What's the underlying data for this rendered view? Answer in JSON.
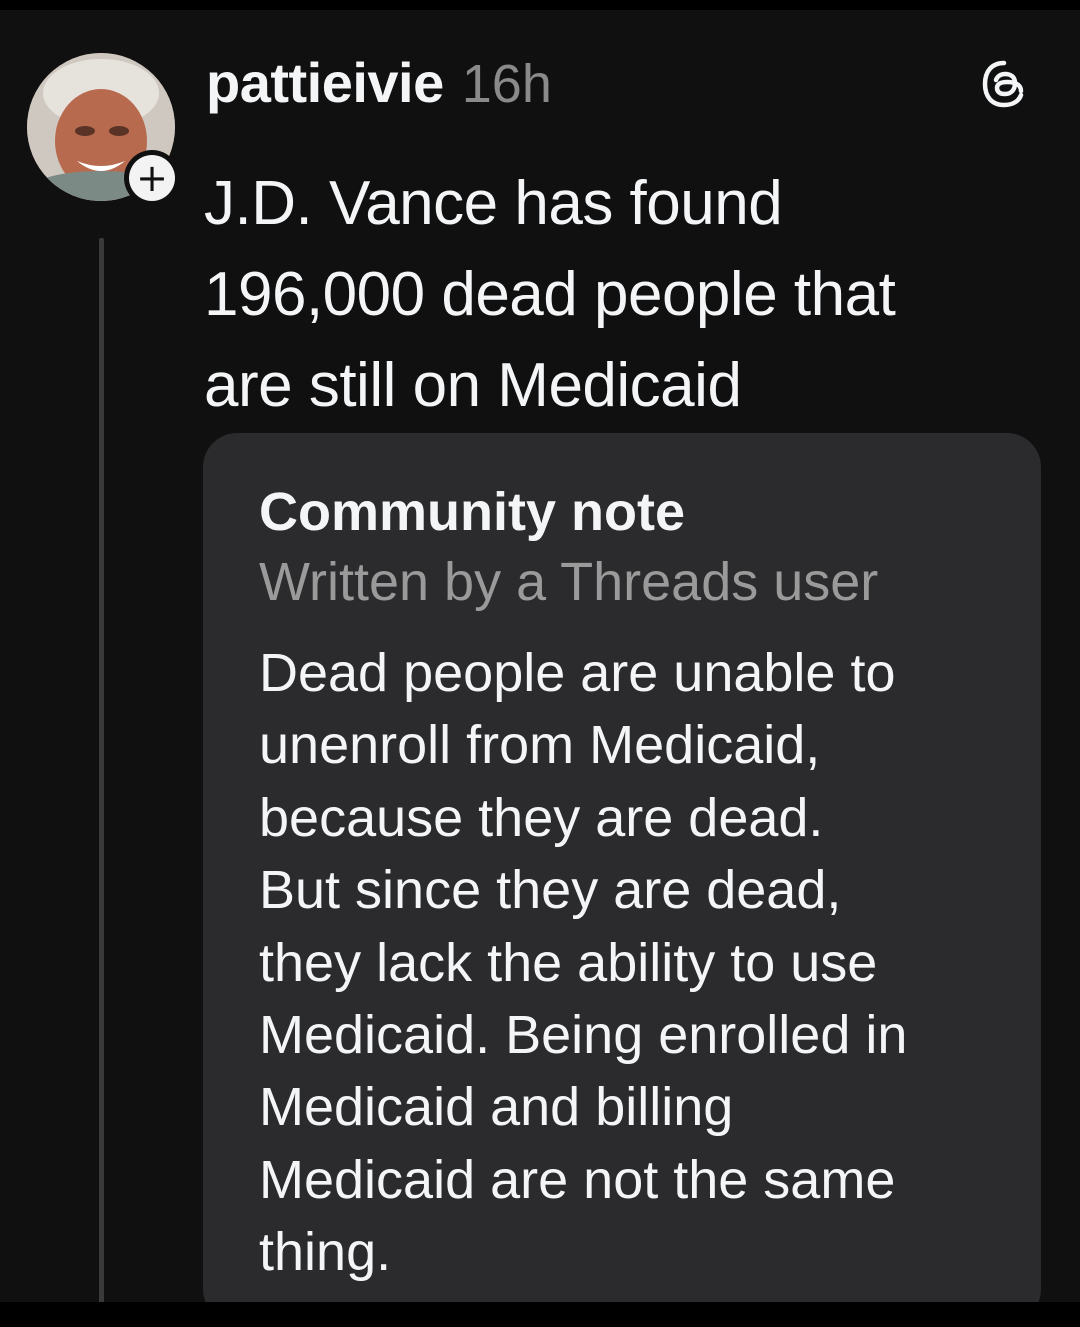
{
  "post": {
    "username": "pattieivie",
    "timestamp": "16h",
    "text_lines": [
      "J.D. Vance has found",
      "196,000 dead people that",
      "are still on Medicaid"
    ]
  },
  "follow_badge": "+",
  "community_note": {
    "title": "Community note",
    "subtitle": "Written by a Threads user",
    "body_lines": [
      "Dead people are unable to",
      "unenroll from Medicaid,",
      "because they are dead.",
      "But since they are dead,",
      "they lack the ability to use",
      "Medicaid. Being enrolled in",
      "Medicaid and billing",
      "Medicaid are not the same",
      "thing."
    ]
  },
  "colors": {
    "background": "#101010",
    "card": "#2b2b2d",
    "text": "#f3f5f7",
    "muted": "#8a8a8a"
  },
  "icons": {
    "app_logo": "threads-logo-icon",
    "follow": "plus-icon"
  }
}
